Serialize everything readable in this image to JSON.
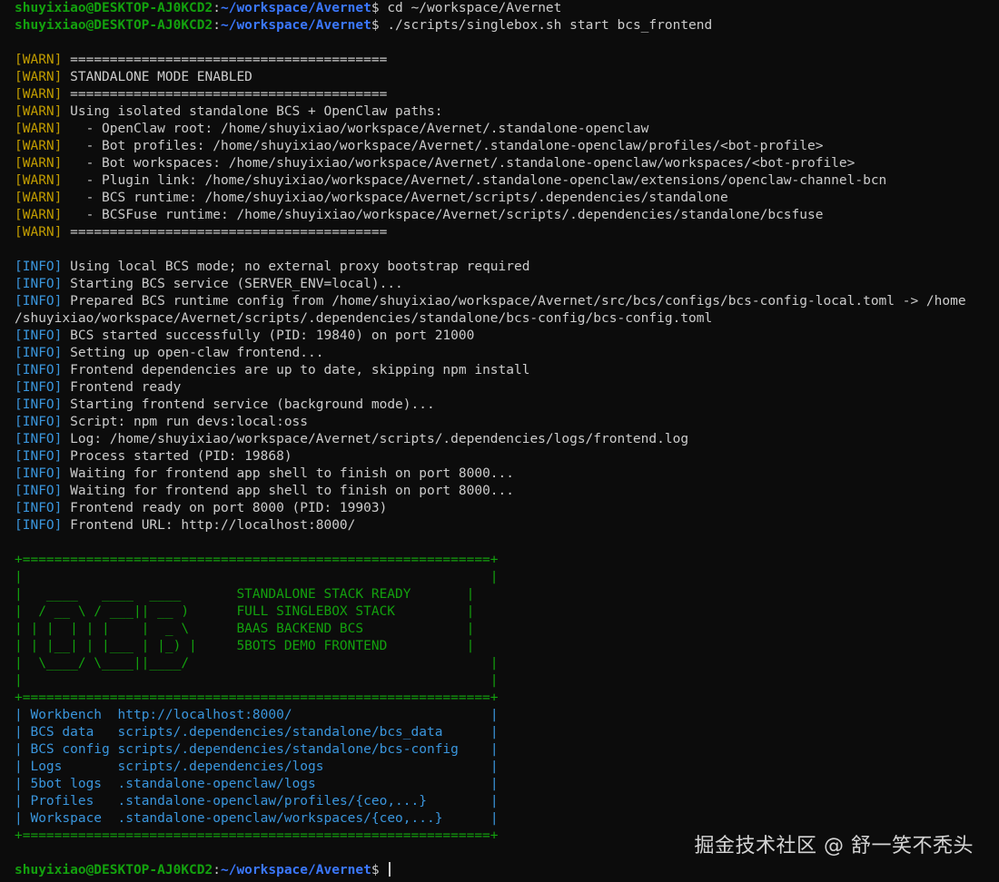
{
  "prompt": {
    "user_host": "shuyixiao@DESKTOP-AJ0KCD2",
    "separator": ":",
    "path": "~/workspace/Avernet",
    "symbol": "$"
  },
  "commands": [
    "cd ~/workspace/Avernet",
    "./scripts/singlebox.sh start bcs_frontend"
  ],
  "warn_tag": "[WARN]",
  "info_tag": "[INFO]",
  "warn_lines": [
    "========================================",
    "STANDALONE MODE ENABLED",
    "========================================",
    "Using isolated standalone BCS + OpenClaw paths:",
    "  - OpenClaw root: /home/shuyixiao/workspace/Avernet/.standalone-openclaw",
    "  - Bot profiles: /home/shuyixiao/workspace/Avernet/.standalone-openclaw/profiles/<bot-profile>",
    "  - Bot workspaces: /home/shuyixiao/workspace/Avernet/.standalone-openclaw/workspaces/<bot-profile>",
    "  - Plugin link: /home/shuyixiao/workspace/Avernet/.standalone-openclaw/extensions/openclaw-channel-bcn",
    "  - BCS runtime: /home/shuyixiao/workspace/Avernet/scripts/.dependencies/standalone",
    "  - BCSFuse runtime: /home/shuyixiao/workspace/Avernet/scripts/.dependencies/standalone/bcsfuse",
    "========================================"
  ],
  "info_lines": [
    "Using local BCS mode; no external proxy bootstrap required",
    "Starting BCS service (SERVER_ENV=local)...",
    "Prepared BCS runtime config from /home/shuyixiao/workspace/Avernet/src/bcs/configs/bcs-config-local.toml -> /home",
    "BCS started successfully (PID: 19840) on port 21000",
    "Setting up open-claw frontend...",
    "Frontend dependencies are up to date, skipping npm install",
    "Frontend ready",
    "Starting frontend service (background mode)...",
    "Script: npm run devs:local:oss",
    "Log: /home/shuyixiao/workspace/Avernet/scripts/.dependencies/logs/frontend.log",
    "Process started (PID: 19868)",
    "Waiting for frontend app shell to finish on port 8000...",
    "Waiting for frontend app shell to finish on port 8000...",
    "Frontend ready on port 8000 (PID: 19903)",
    "Frontend URL: http://localhost:8000/"
  ],
  "info_wrap_continuation": "/shuyixiao/workspace/Avernet/scripts/.dependencies/standalone/bcs-config/bcs-config.toml",
  "banner": {
    "border": "+===========================================================+",
    "rows": [
      {
        "art": "|                                                           |",
        "text": "",
        "end": ""
      },
      {
        "art": "|   ____   ____  ____       ",
        "text": "STANDALONE STACK READY",
        "end": "       |"
      },
      {
        "art": "|  / __ \\ / ___|| __ )      ",
        "text": "FULL SINGLEBOX STACK",
        "end": "         |"
      },
      {
        "art": "| | |  | | |    |  _ \\      ",
        "text": "BAAS BACKEND BCS",
        "end": "             |"
      },
      {
        "art": "| | |__| | |___ | |_) |     ",
        "text": "5BOTS DEMO FRONTEND",
        "end": "          |"
      },
      {
        "art": "|  \\____/ \\____||____/                                      |",
        "text": "",
        "end": ""
      },
      {
        "art": "|                                                           |",
        "text": "",
        "end": ""
      }
    ],
    "entries": [
      {
        "label": "Workbench ",
        "value": "http://localhost:8000/",
        "pad": "                         "
      },
      {
        "label": "BCS data  ",
        "value": "scripts/.dependencies/standalone/bcs_data",
        "pad": "      "
      },
      {
        "label": "BCS config",
        "value": "scripts/.dependencies/standalone/bcs-config",
        "pad": "    "
      },
      {
        "label": "Logs      ",
        "value": "scripts/.dependencies/logs",
        "pad": "                     "
      },
      {
        "label": "5bot logs ",
        "value": ".standalone-openclaw/logs",
        "pad": "                      "
      },
      {
        "label": "Profiles  ",
        "value": ".standalone-openclaw/profiles/{ceo,...}",
        "pad": "        "
      },
      {
        "label": "Workspace ",
        "value": ".standalone-openclaw/workspaces/{ceo,...}",
        "pad": "      "
      }
    ]
  },
  "watermark": "掘金技术社区 @ 舒一笑不秃头",
  "colors": {
    "background": "#0c0c0c",
    "user_host": "#13a10e",
    "path": "#3b78ff",
    "warn": "#c19c00",
    "info": "#3a96dd",
    "text": "#cccccc"
  }
}
